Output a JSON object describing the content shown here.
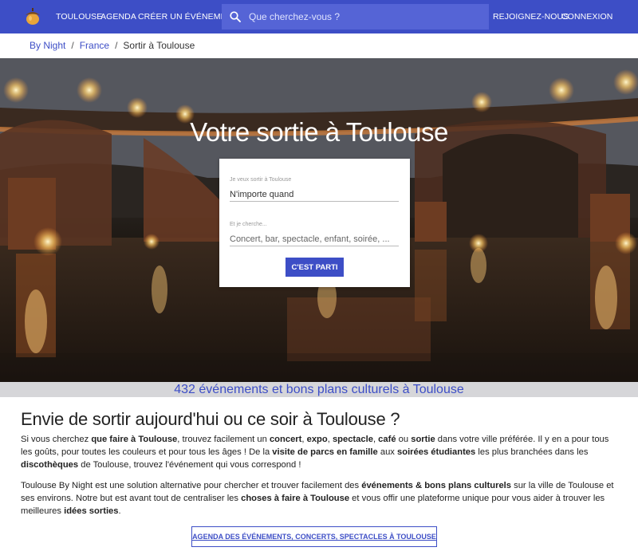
{
  "nav": {
    "logo_icon": "acorn-logo-icon",
    "city": "TOULOUSE",
    "agenda": "AGENDA",
    "create_event": "CRÉER UN ÉVÉNEMENT",
    "search_placeholder": "Que cherchez-vous ?",
    "join": "REJOIGNEZ-NOUS",
    "login": "CONNEXION",
    "background_color": "#3d4ec6"
  },
  "breadcrumb": {
    "items": [
      "By Night",
      "France"
    ],
    "current": "Sortir à Toulouse",
    "separator": "/"
  },
  "hero": {
    "title": "Votre sortie à Toulouse",
    "when_label": "Je veux sortir à Toulouse",
    "when_value": "N'importe quand",
    "what_label": "Et je cherche...",
    "what_placeholder": "Concert, bar, spectacle, enfant, soirée, ...",
    "submit": "C'EST PARTI"
  },
  "count_bar": {
    "text": "432 événements et bons plans culturels à Toulouse"
  },
  "content": {
    "title": "Envie de sortir aujourd'hui ou ce soir à Toulouse ?",
    "p1": [
      {
        "t": "Si vous cherchez "
      },
      {
        "t": "que faire à Toulouse",
        "b": true
      },
      {
        "t": ", trouvez facilement un "
      },
      {
        "t": "concert",
        "b": true
      },
      {
        "t": ", "
      },
      {
        "t": "expo",
        "b": true
      },
      {
        "t": ", "
      },
      {
        "t": "spectacle",
        "b": true
      },
      {
        "t": ", "
      },
      {
        "t": "café",
        "b": true
      },
      {
        "t": " ou "
      },
      {
        "t": "sortie",
        "b": true
      },
      {
        "t": " dans votre ville préférée. Il y en a pour tous les goûts, pour toutes les couleurs et pour tous les âges ! De la "
      },
      {
        "t": "visite de parcs en famille",
        "b": true
      },
      {
        "t": " aux "
      },
      {
        "t": "soirées étudiantes",
        "b": true
      },
      {
        "t": " les plus branchées dans les "
      },
      {
        "t": "discothèques",
        "b": true
      },
      {
        "t": " de Toulouse, trouvez l'événement qui vous correspond !"
      }
    ],
    "p2": [
      {
        "t": "Toulouse By Night est une solution alternative pour chercher et trouver facilement des "
      },
      {
        "t": "événements & bons plans culturels",
        "b": true
      },
      {
        "t": " sur la ville de Toulouse et ses environs. Notre but est avant tout de centraliser les "
      },
      {
        "t": "choses à faire à Toulouse",
        "b": true
      },
      {
        "t": " et vous offir une plateforme unique pour vous aider à trouver les meilleures "
      },
      {
        "t": "idées sorties",
        "b": true
      },
      {
        "t": "."
      }
    ],
    "agenda_button": "AGENDA DES ÉVÉNEMENTS, CONCERTS, SPECTACLES À TOULOUSE"
  }
}
